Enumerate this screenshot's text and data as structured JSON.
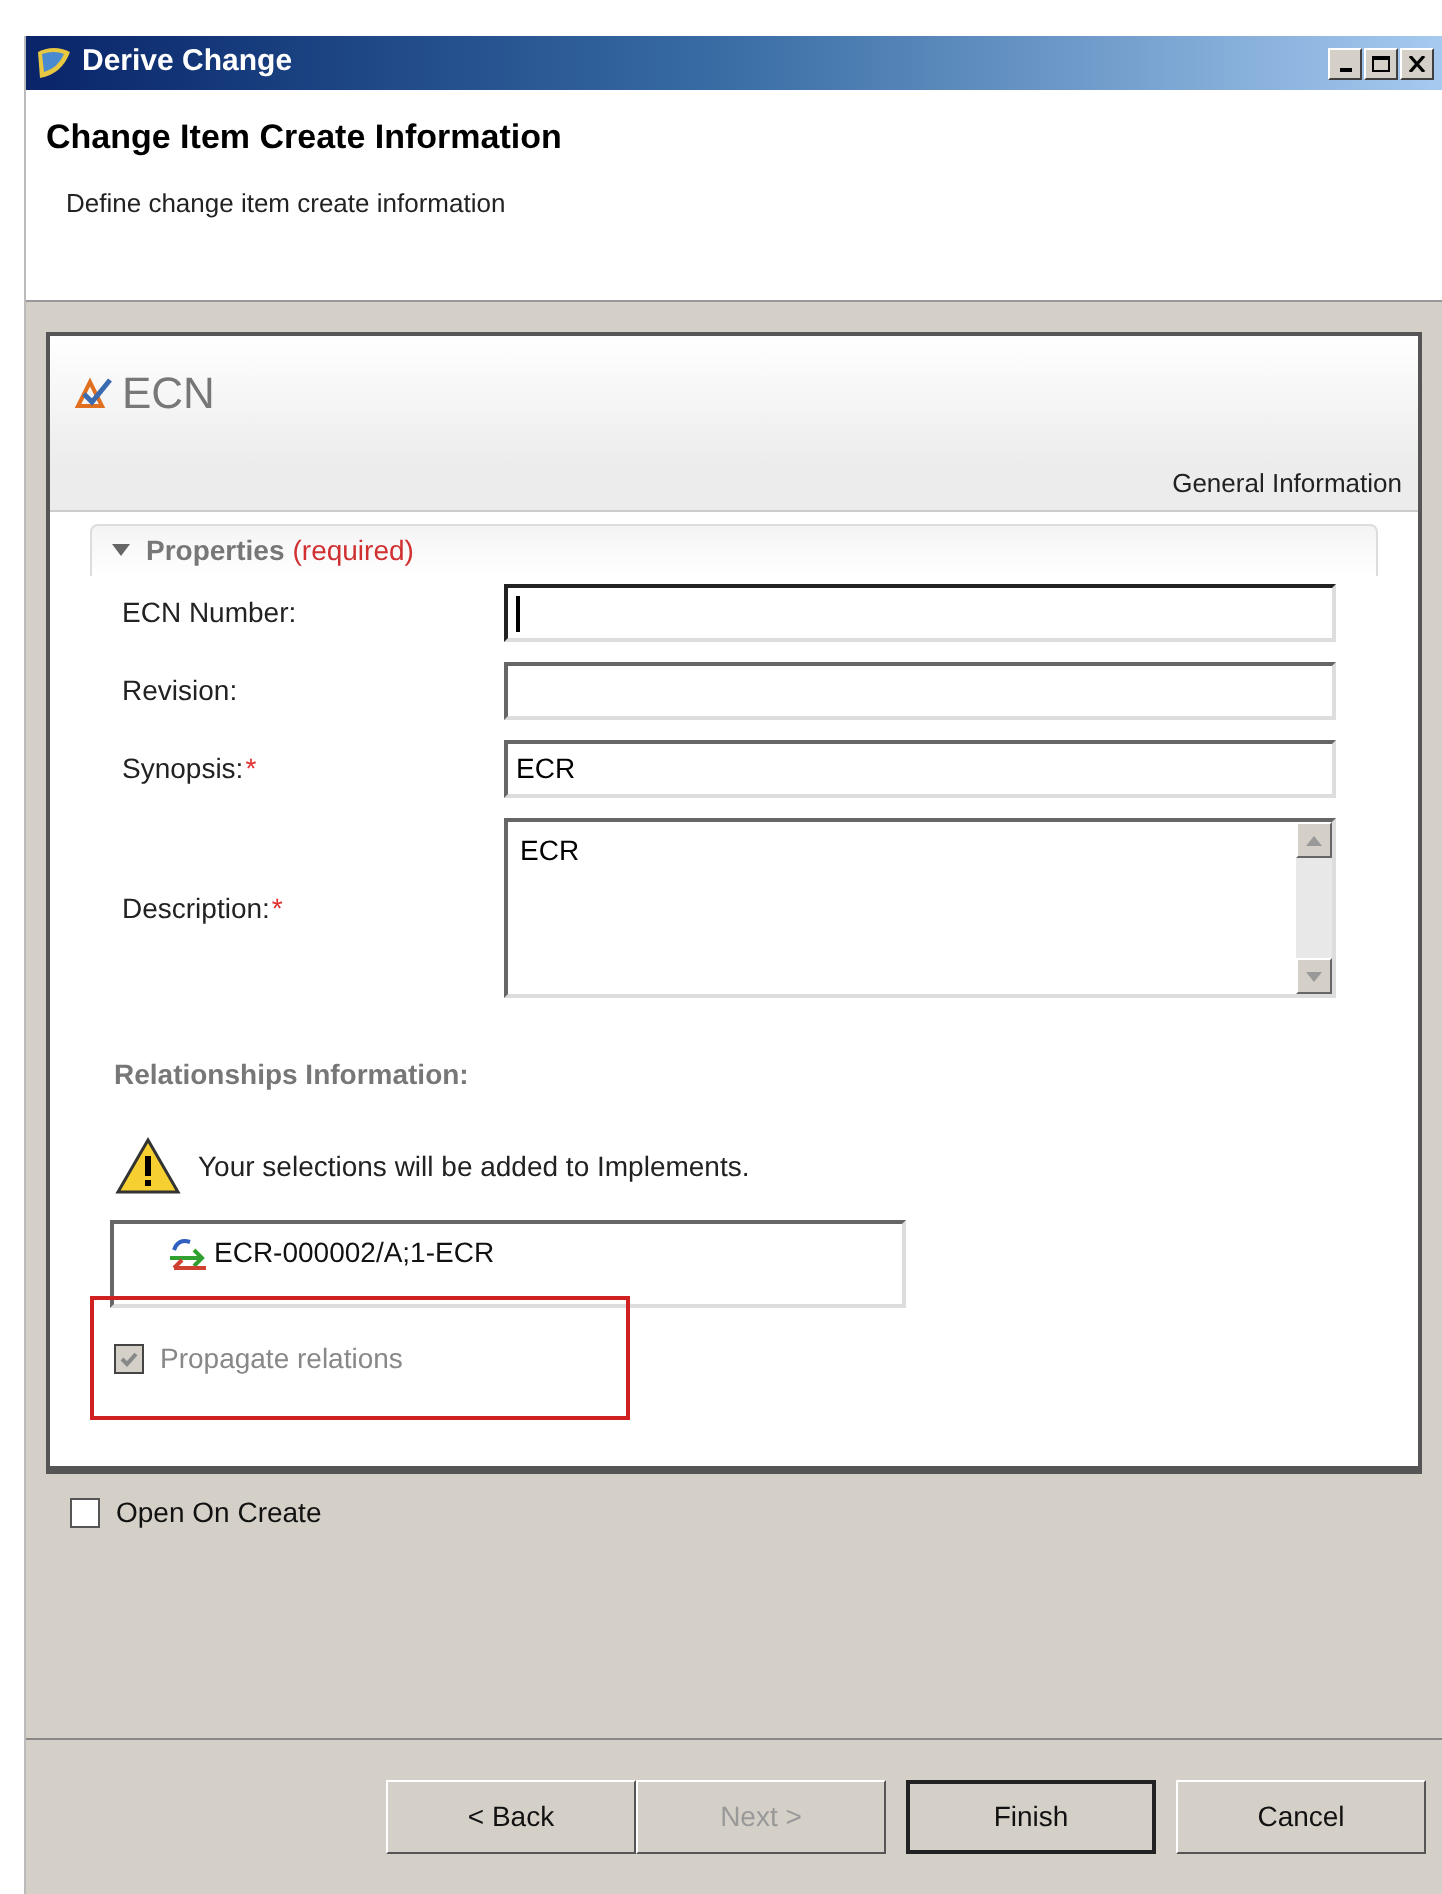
{
  "window": {
    "title": "Derive Change"
  },
  "header": {
    "title": "Change Item Create Information",
    "subtitle": "Define change item create information"
  },
  "form": {
    "title": "ECN",
    "tab": "General Information",
    "section": {
      "title": "Properties",
      "note": "(required)",
      "expanded": true
    },
    "fields": [
      {
        "label": "ECN Number:",
        "kind": "text",
        "focused": true
      },
      {
        "label": "Revision:",
        "kind": "text",
        "focused": false
      },
      {
        "label": "Synopsis:",
        "required_mark": "*",
        "kind": "text",
        "value": "ECR",
        "focused": false
      },
      {
        "label": "Description:",
        "required_mark": "*",
        "kind": "textarea",
        "value": "ECR",
        "focused": false
      }
    ],
    "relationships": {
      "title": "Relationships Information:",
      "warning": "Your selections will be added to Implements.",
      "items": [
        "ECR-000002/A;1-ECR"
      ],
      "propagate": {
        "label": "Propagate relations",
        "checked": true,
        "disabled": true,
        "highlighted": true
      }
    }
  },
  "open_on_create": {
    "label": "Open On Create",
    "checked": false
  },
  "buttons": [
    {
      "label": "< Back",
      "disabled": false,
      "default": false
    },
    {
      "label": "Next >",
      "disabled": true,
      "default": false
    },
    {
      "label": "Finish",
      "disabled": false,
      "default": true
    },
    {
      "label": "Cancel",
      "disabled": false,
      "default": false
    }
  ]
}
